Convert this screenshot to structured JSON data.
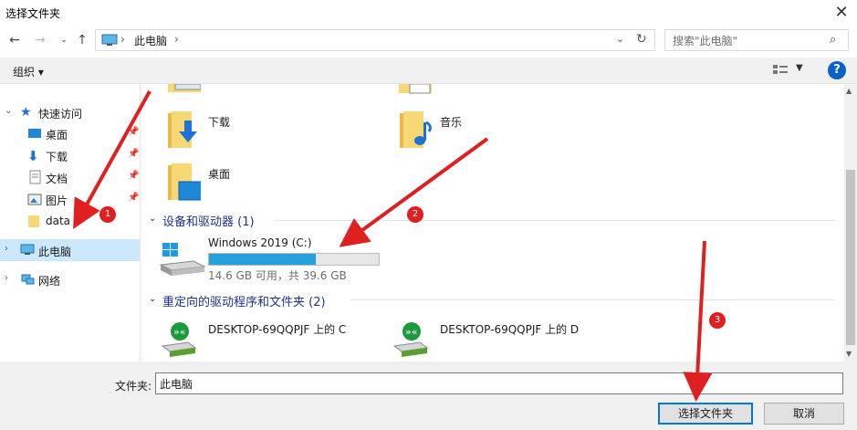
{
  "window": {
    "title": "选择文件夹"
  },
  "nav": {
    "path_root": "此电脑",
    "search_placeholder": "搜索\"此电脑\""
  },
  "toolbar": {
    "organize": "组织 ▾"
  },
  "sidebar": {
    "items": [
      {
        "label": "快速访问",
        "icon": "star-icon"
      },
      {
        "label": "桌面",
        "icon": "desktop-icon",
        "pinned": true
      },
      {
        "label": "下载",
        "icon": "download-icon",
        "pinned": true
      },
      {
        "label": "文档",
        "icon": "document-icon",
        "pinned": true
      },
      {
        "label": "图片",
        "icon": "picture-icon",
        "pinned": true
      },
      {
        "label": "data",
        "icon": "folder-icon"
      },
      {
        "label": "此电脑",
        "icon": "computer-icon",
        "selected": true
      },
      {
        "label": "网络",
        "icon": "network-icon"
      }
    ]
  },
  "main": {
    "folders": [
      {
        "label": "下载",
        "icon": "download-folder-icon"
      },
      {
        "label": "音乐",
        "icon": "music-folder-icon"
      },
      {
        "label": "桌面",
        "icon": "desktop-folder-icon"
      }
    ],
    "devices_group": "设备和驱动器 (1)",
    "drive": {
      "name": "Windows 2019 (C:)",
      "free_text": "14.6 GB 可用，共 39.6 GB",
      "used_fraction": 0.63
    },
    "redirect_group": "重定向的驱动程序和文件夹 (2)",
    "redirects": [
      {
        "label": "DESKTOP-69QQPJF 上的 C"
      },
      {
        "label": "DESKTOP-69QQPJF 上的 D"
      }
    ]
  },
  "bottom": {
    "folder_label": "文件夹:",
    "folder_value": "此电脑",
    "select_button": "选择文件夹",
    "cancel_button": "取消"
  },
  "annotations": {
    "badge1": "1",
    "badge2": "2",
    "badge3": "3"
  },
  "colors": {
    "accent": "#0078d7",
    "selected_bg": "#cce8ff",
    "drive_fill": "#26a0da",
    "arrow": "#e02020"
  }
}
